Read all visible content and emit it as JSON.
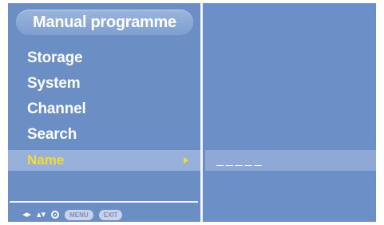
{
  "menu": {
    "title": "Manual programme",
    "items": [
      {
        "label": "Storage"
      },
      {
        "label": "System"
      },
      {
        "label": "Channel"
      },
      {
        "label": "Search"
      }
    ],
    "selected": {
      "label": "Name",
      "value": "_____"
    }
  },
  "footer": {
    "lr_glyph": "◂▸",
    "ud_glyph": "▴▾",
    "menu_key": "MENU",
    "exit_key": "EXIT"
  },
  "colors": {
    "background": "#6a8fc6",
    "highlight": "#97b1da",
    "selected_text": "#f4dc2a"
  },
  "icons": [
    "left-right-arrows-icon",
    "up-down-arrows-icon",
    "ok-circle-icon"
  ]
}
